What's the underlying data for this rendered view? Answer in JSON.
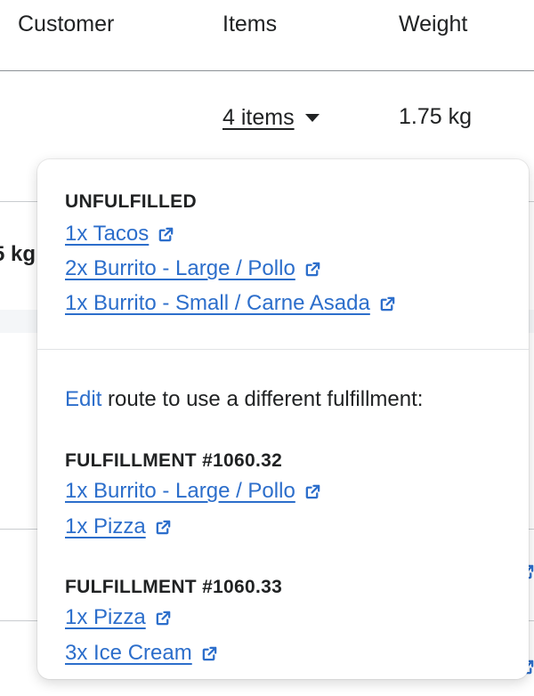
{
  "table": {
    "headers": {
      "customer": "Customer",
      "items": "Items",
      "weight": "Weight"
    },
    "row1": {
      "items_label": "4 items",
      "weight": "1.75 kg"
    },
    "row2_partial_weight": "5 kg"
  },
  "popover": {
    "unfulfilled_title": "UNFULFILLED",
    "unfulfilled_items": [
      "1x Tacos",
      "2x Burrito - Large / Pollo",
      "1x Burrito - Small / Carne Asada"
    ],
    "edit_link": "Edit",
    "edit_text": " route to use a different fulfillment:",
    "fulfillments": [
      {
        "title": "FULFILLMENT #1060.32",
        "items": [
          "1x Burrito - Large / Pollo",
          "1x Pizza"
        ]
      },
      {
        "title": "FULFILLMENT #1060.33",
        "items": [
          "1x Pizza",
          "3x Ice Cream"
        ]
      }
    ]
  },
  "icons": {
    "dropdown": "caret-down-icon",
    "item_link": "external-link-icon"
  },
  "colors": {
    "link": "#2c6ecb",
    "text": "#202223",
    "divider": "#c9cccf"
  }
}
